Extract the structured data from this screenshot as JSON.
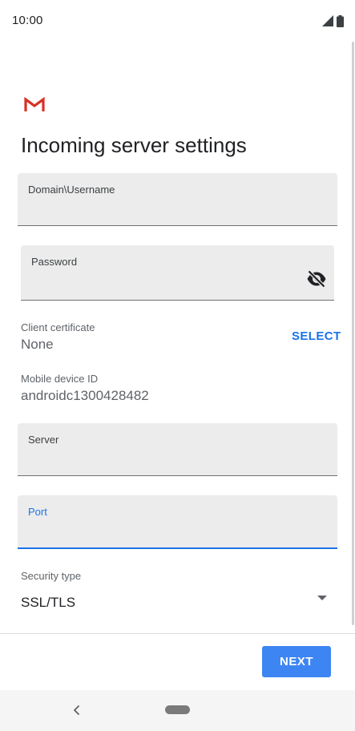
{
  "status_bar": {
    "time": "10:00",
    "signal_icon": "cellular-signal-icon",
    "battery_icon": "battery-icon"
  },
  "header": {
    "logo_icon": "gmail-logo-icon",
    "title": "Incoming server settings"
  },
  "form": {
    "username": {
      "label": "Domain\\Username",
      "value": ""
    },
    "password": {
      "label": "Password",
      "value": "",
      "toggle_icon": "visibility-off-icon"
    },
    "client_certificate": {
      "label": "Client certificate",
      "value": "None",
      "action_label": "SELECT"
    },
    "mobile_device_id": {
      "label": "Mobile device ID",
      "value": "androidc1300428482"
    },
    "server": {
      "label": "Server",
      "value": ""
    },
    "port": {
      "label": "Port",
      "value": "",
      "focused": true
    },
    "security_type": {
      "label": "Security type",
      "value": "SSL/TLS",
      "arrow_icon": "dropdown-arrow-icon"
    }
  },
  "footer": {
    "next_label": "NEXT"
  },
  "nav_bar": {
    "back_icon": "back-chevron-icon",
    "home_icon": "home-pill-icon"
  },
  "colors": {
    "accent": "#1a73e8",
    "button": "#3c85f3",
    "field_bg": "#ececec",
    "gmail_red": "#d93025"
  }
}
